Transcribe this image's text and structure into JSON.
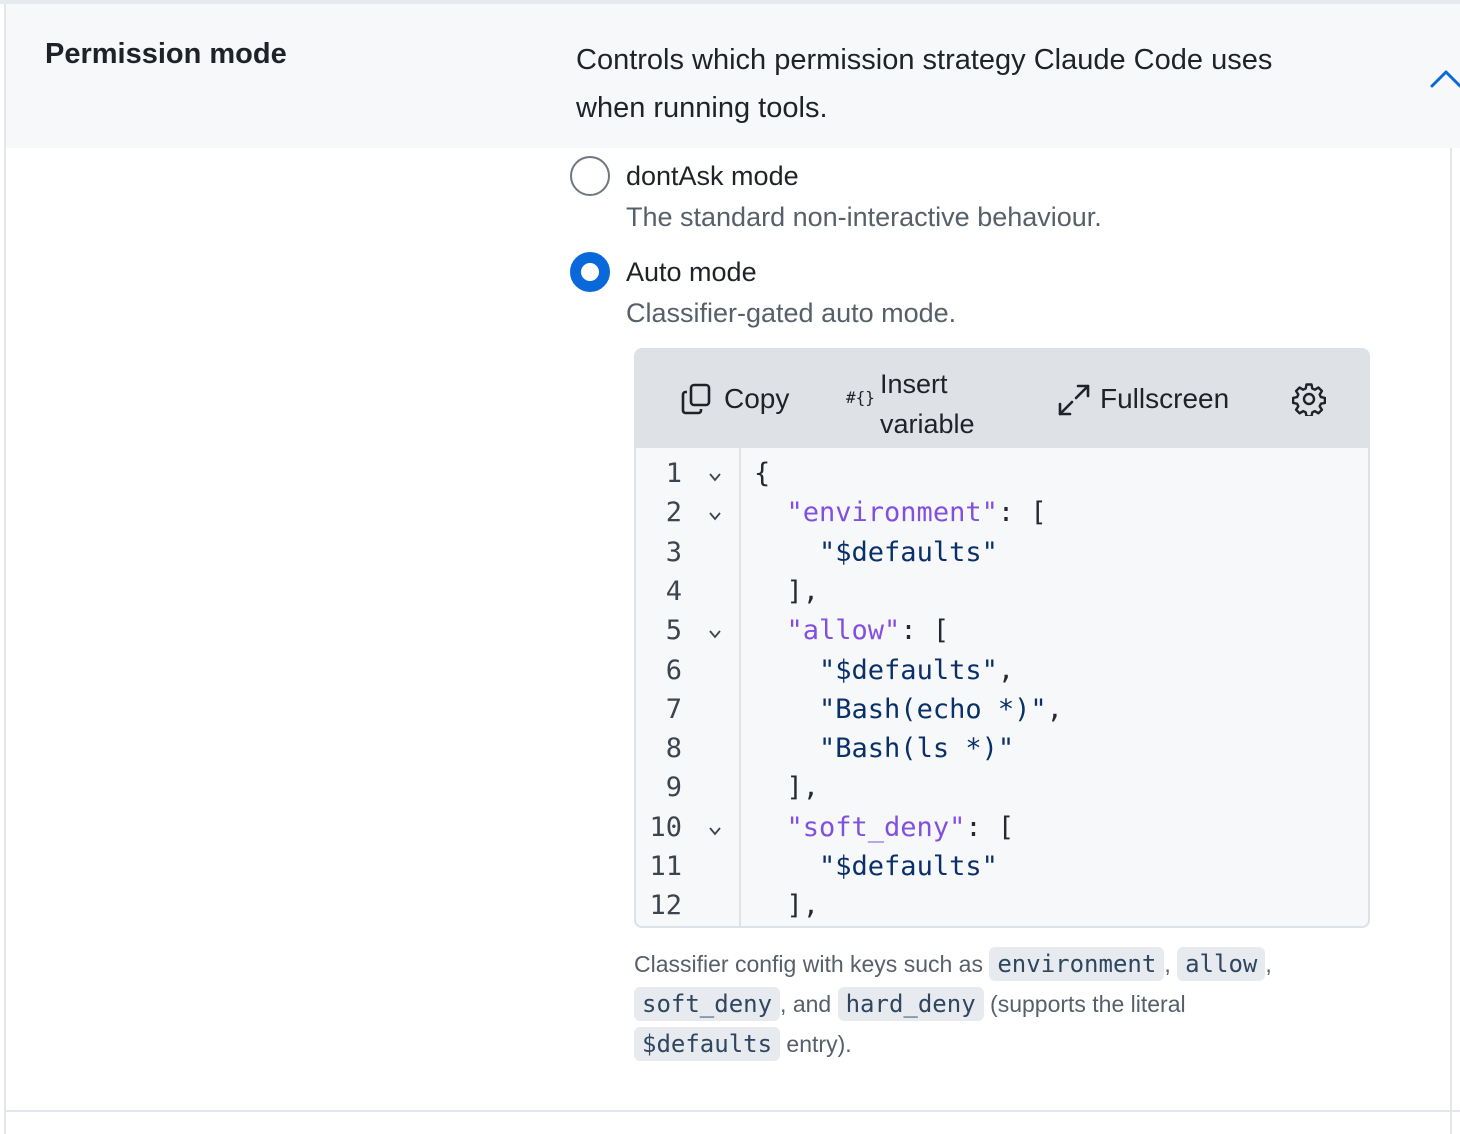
{
  "setting": {
    "title": "Permission mode",
    "description": "Controls which permission strategy Claude Code uses when running tools."
  },
  "options": [
    {
      "label": "dontAsk mode",
      "help": "The standard non-interactive behaviour.",
      "selected": false
    },
    {
      "label": "Auto mode",
      "help": "Classifier-gated auto mode.",
      "selected": true
    }
  ],
  "editor": {
    "toolbar": {
      "copy": "Copy",
      "insert_variable": "Insert variable",
      "insert_variable_icon": "#{}",
      "fullscreen": "Fullscreen",
      "settings_icon": "gear-icon"
    },
    "lines": [
      {
        "n": "1",
        "fold": true
      },
      {
        "n": "2",
        "fold": true
      },
      {
        "n": "3",
        "fold": false
      },
      {
        "n": "4",
        "fold": false
      },
      {
        "n": "5",
        "fold": true
      },
      {
        "n": "6",
        "fold": false
      },
      {
        "n": "7",
        "fold": false
      },
      {
        "n": "8",
        "fold": false
      },
      {
        "n": "9",
        "fold": false
      },
      {
        "n": "10",
        "fold": true
      },
      {
        "n": "11",
        "fold": false
      },
      {
        "n": "12",
        "fold": false
      }
    ],
    "code": [
      [
        {
          "t": "{",
          "c": "punc"
        }
      ],
      [
        {
          "t": "  ",
          "c": "punc"
        },
        {
          "t": "\"environment\"",
          "c": "key"
        },
        {
          "t": ": [",
          "c": "punc"
        }
      ],
      [
        {
          "t": "    ",
          "c": "punc"
        },
        {
          "t": "\"$defaults\"",
          "c": "str"
        }
      ],
      [
        {
          "t": "  ],",
          "c": "punc"
        }
      ],
      [
        {
          "t": "  ",
          "c": "punc"
        },
        {
          "t": "\"allow\"",
          "c": "key"
        },
        {
          "t": ": [",
          "c": "punc"
        }
      ],
      [
        {
          "t": "    ",
          "c": "punc"
        },
        {
          "t": "\"$defaults\"",
          "c": "str"
        },
        {
          "t": ",",
          "c": "punc"
        }
      ],
      [
        {
          "t": "    ",
          "c": "punc"
        },
        {
          "t": "\"Bash(echo *)\"",
          "c": "str"
        },
        {
          "t": ",",
          "c": "punc"
        }
      ],
      [
        {
          "t": "    ",
          "c": "punc"
        },
        {
          "t": "\"Bash(ls *)\"",
          "c": "str"
        }
      ],
      [
        {
          "t": "  ],",
          "c": "punc"
        }
      ],
      [
        {
          "t": "  ",
          "c": "punc"
        },
        {
          "t": "\"soft_deny\"",
          "c": "key"
        },
        {
          "t": ": [",
          "c": "punc"
        }
      ],
      [
        {
          "t": "    ",
          "c": "punc"
        },
        {
          "t": "\"$defaults\"",
          "c": "str"
        }
      ],
      [
        {
          "t": "  ],",
          "c": "punc"
        }
      ]
    ]
  },
  "help": {
    "prefix": "Classifier config with keys such as ",
    "code_environment": "environment",
    "sep1": ", ",
    "code_allow": "allow",
    "sep2": ",",
    "code_soft_deny": "soft_deny",
    "sep3": ", and ",
    "code_hard_deny": "hard_deny",
    "mid": " (supports the literal ",
    "code_defaults": "$defaults",
    "suffix": " entry)."
  },
  "colors": {
    "accent": "#0969da",
    "json_key": "#8250df",
    "json_string": "#0a3069"
  }
}
